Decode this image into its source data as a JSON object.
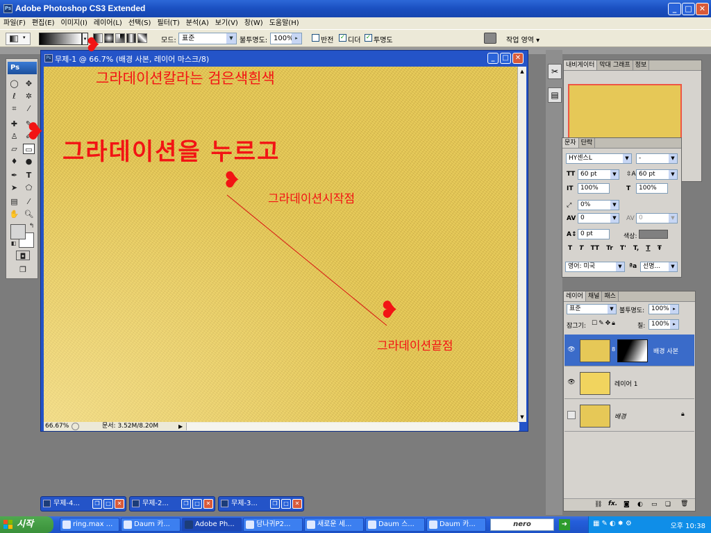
{
  "window": {
    "title": "Adobe Photoshop CS3 Extended",
    "min_glyph": "_",
    "max_glyph": "□",
    "close_glyph": "✕"
  },
  "menu": [
    "파일(F)",
    "편집(E)",
    "이미지(I)",
    "레이어(L)",
    "선택(S)",
    "필터(T)",
    "분석(A)",
    "보기(V)",
    "창(W)",
    "도움말(H)"
  ],
  "options": {
    "mode_label": "모드:",
    "mode_value": "표준",
    "opacity_label": "불투명도:",
    "opacity_value": "100%",
    "reverse_label": "반전",
    "dither_label": "디더",
    "transparency_label": "투명도",
    "workspace_label": "작업 영역 ▾"
  },
  "toolbox": {
    "logo": "Ps"
  },
  "document": {
    "title": "무제-1 @ 66.7% (배경 사본, 레이어 마스크/8)",
    "zoom": "66.67%",
    "doc_size": "문서: 3.52M/8.20M"
  },
  "navigator_panel": {
    "tabs": [
      "내비게이터",
      "막대 그래프",
      "정보"
    ]
  },
  "character_panel": {
    "tabs": [
      "문자",
      "단락"
    ],
    "font_family": "HY센스L",
    "font_style": "-",
    "font_size": "60 pt",
    "leading": "60 pt",
    "vertical_scale": "100%",
    "horizontal_scale": "100%",
    "tracking": "0%",
    "kerning": "0",
    "kerning2": "0",
    "baseline_shift": "0 pt",
    "color_label": "색상:",
    "language": "영어: 미국",
    "anti_alias": "선명...",
    "type_buttons": [
      "T",
      "T",
      "TT",
      "Tr",
      "T'",
      "T,",
      "T",
      "Ŧ"
    ]
  },
  "layers_panel": {
    "tabs": [
      "레이어",
      "채널",
      "패스"
    ],
    "blend_mode": "표준",
    "opacity_label": "불투명도:",
    "opacity": "100%",
    "lock_label": "잠그기:",
    "fill_label": "칠:",
    "fill": "100%",
    "layers": [
      {
        "name": "배경 사본",
        "visible": true,
        "selected": true,
        "mask": true
      },
      {
        "name": "레이어 1",
        "visible": true,
        "selected": false,
        "mask": false
      },
      {
        "name": "배경",
        "visible": false,
        "selected": false,
        "mask": false,
        "locked": true
      }
    ],
    "footer_icons": [
      "link-icon",
      "fx-icon",
      "mask-icon",
      "adjustment-icon",
      "group-icon",
      "new-layer-icon",
      "trash-icon"
    ]
  },
  "minimized_docs": [
    "무제-4...",
    "무제-2...",
    "무제-3..."
  ],
  "taskbar": {
    "start": "시작",
    "items": [
      "ring.max ...",
      "Daum 카...",
      "Adobe Ph...",
      "담나귀P2...",
      "새로운 세...",
      "Daum 스...",
      "Daum 카..."
    ],
    "search_label": "nero",
    "clock": "오후 10:38"
  },
  "annotations": {
    "gradient_color": "그라데이션칼라는 검은색흰색",
    "press_gradient": "그라데이션을 누르고",
    "start_point": "그라데이션시작점",
    "end_point": "그라데이션끝점"
  },
  "colors": {
    "canvas": "#e6c857",
    "annotation": "#f21414",
    "titlebar": "#245edb"
  }
}
